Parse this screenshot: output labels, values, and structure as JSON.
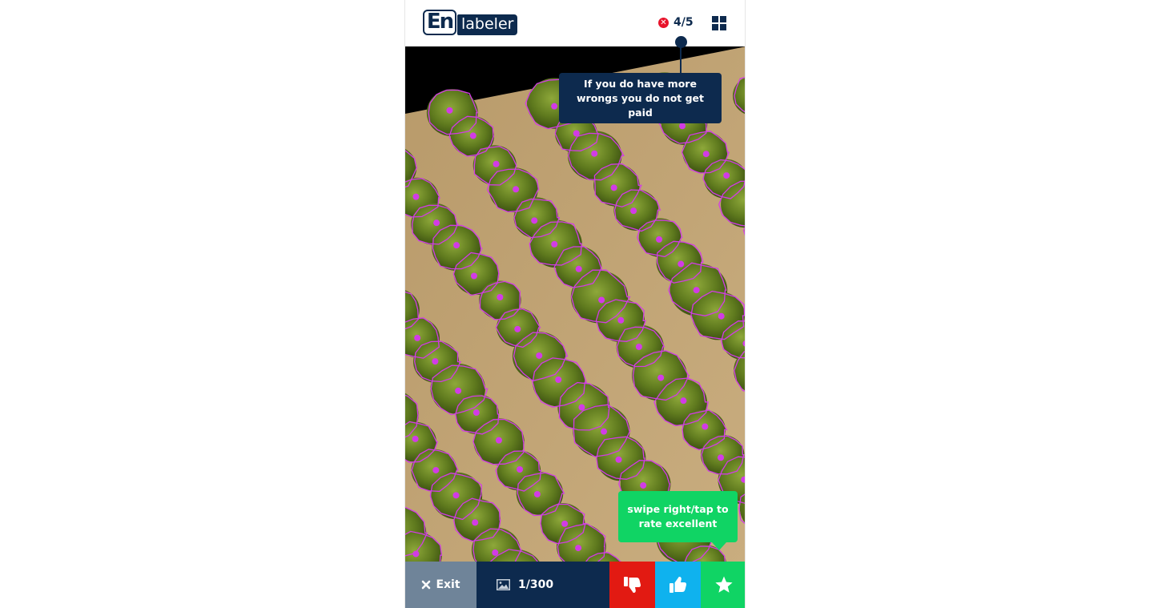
{
  "header": {
    "logo_en": "En",
    "logo_labeler": "labeler",
    "wrong_counter": "4/5"
  },
  "tooltips": {
    "wrongs": "If you do have more wrongs you do not get paid",
    "excellent": "swipe right/tap to rate excellent"
  },
  "footer": {
    "exit_label": "Exit",
    "image_counter": "1/300"
  },
  "colors": {
    "brand_navy": "#0d2a4e",
    "exit_gray": "#6f8499",
    "bad_red": "#e21a12",
    "good_blue": "#0fb2ee",
    "excellent_green": "#10d464",
    "annotation_magenta": "#d23be6",
    "error_red": "#e8132b"
  },
  "icons": {
    "wrong": "x-circle-icon",
    "grid": "grid-icon",
    "exit": "close-icon",
    "image": "image-icon",
    "bad": "thumbs-down-icon",
    "good": "thumbs-up-icon",
    "excellent": "star-icon"
  }
}
